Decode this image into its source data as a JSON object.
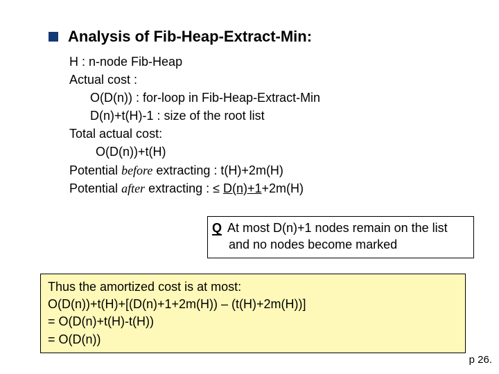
{
  "title": "Analysis of Fib-Heap-Extract-Min:",
  "lines": {
    "l1": "H : n-node Fib-Heap",
    "l2": "Actual cost :",
    "l3": "O(D(n)) : for-loop in Fib-Heap-Extract-Min",
    "l4": "D(n)+t(H)-1 : size of the root list",
    "l5": "Total actual cost:",
    "l6": "O(D(n))+t(H)",
    "l7a": "Potential ",
    "l7b": "before",
    "l7c": " extracting : t(H)+2m(H)",
    "l8a": "Potential ",
    "l8b": "after",
    "l8c": " extracting : ≤ ",
    "l8d": "D(n)+1",
    "l8e": "+2m(H)"
  },
  "callout": {
    "q": "Q",
    "line1": " At most D(n)+1 nodes remain on the list",
    "line2": "and no nodes become marked"
  },
  "conclusion": {
    "l1": "Thus the amortized cost is at most:",
    "l2": "O(D(n))+t(H)+[(D(n)+1+2m(H)) – (t(H)+2m(H))]",
    "l3": "= O(D(n)+t(H)-t(H))",
    "l4": "= O(D(n))"
  },
  "pagenum": "p 26."
}
